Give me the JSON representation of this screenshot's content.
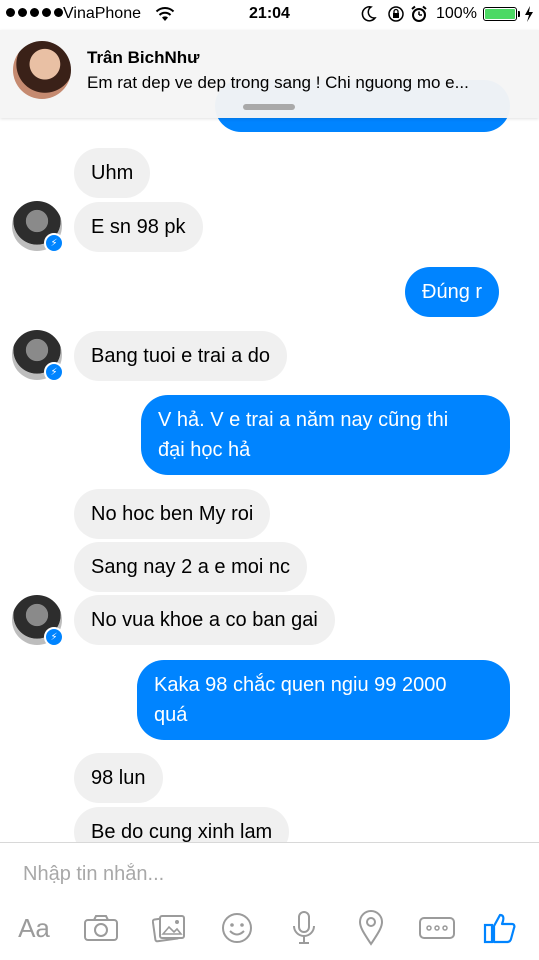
{
  "status_bar": {
    "carrier": "VinaPhone",
    "time": "21:04",
    "battery_percent": "100%",
    "battery_level": 1.0,
    "signal_dots": 5
  },
  "notification": {
    "sender": "Trân BichNhư",
    "message": "Em rat dep ve dep trong sang ! Chi nguong mo e..."
  },
  "messages": [
    {
      "from": "in",
      "text": "Uhm"
    },
    {
      "from": "in",
      "text": "E sn 98 pk"
    },
    {
      "from": "out",
      "text": "Đúng r"
    },
    {
      "from": "in",
      "text": "Bang tuoi e trai a do"
    },
    {
      "from": "out",
      "text_line1": "V hả. V e trai a năm nay cũng thi",
      "text_line2": "đại học hả"
    },
    {
      "from": "in",
      "text": "No hoc ben My roi"
    },
    {
      "from": "in",
      "text": "Sang nay 2 a e moi nc"
    },
    {
      "from": "in",
      "text": "No vua khoe a co ban gai"
    },
    {
      "from": "out",
      "text_line1": "Kaka 98 chắc quen ngiu 99 2000",
      "text_line2": "quá"
    },
    {
      "from": "in",
      "text": "98 lun"
    },
    {
      "from": "in",
      "text": "Be do cung xinh lam"
    }
  ],
  "composer": {
    "placeholder": "Nhập tin nhắn...",
    "text_button_label": "Aa"
  },
  "toolbar_icons": [
    "text-format-icon",
    "camera-icon",
    "gallery-icon",
    "emoji-icon",
    "microphone-icon",
    "location-icon",
    "more-icon",
    "like-thumb-icon"
  ],
  "colors": {
    "outgoing_bubble": "#0084ff",
    "incoming_bubble": "#f0f0f0",
    "like_icon": "#0084ff",
    "toolbar_icon": "#9b9b9b"
  }
}
